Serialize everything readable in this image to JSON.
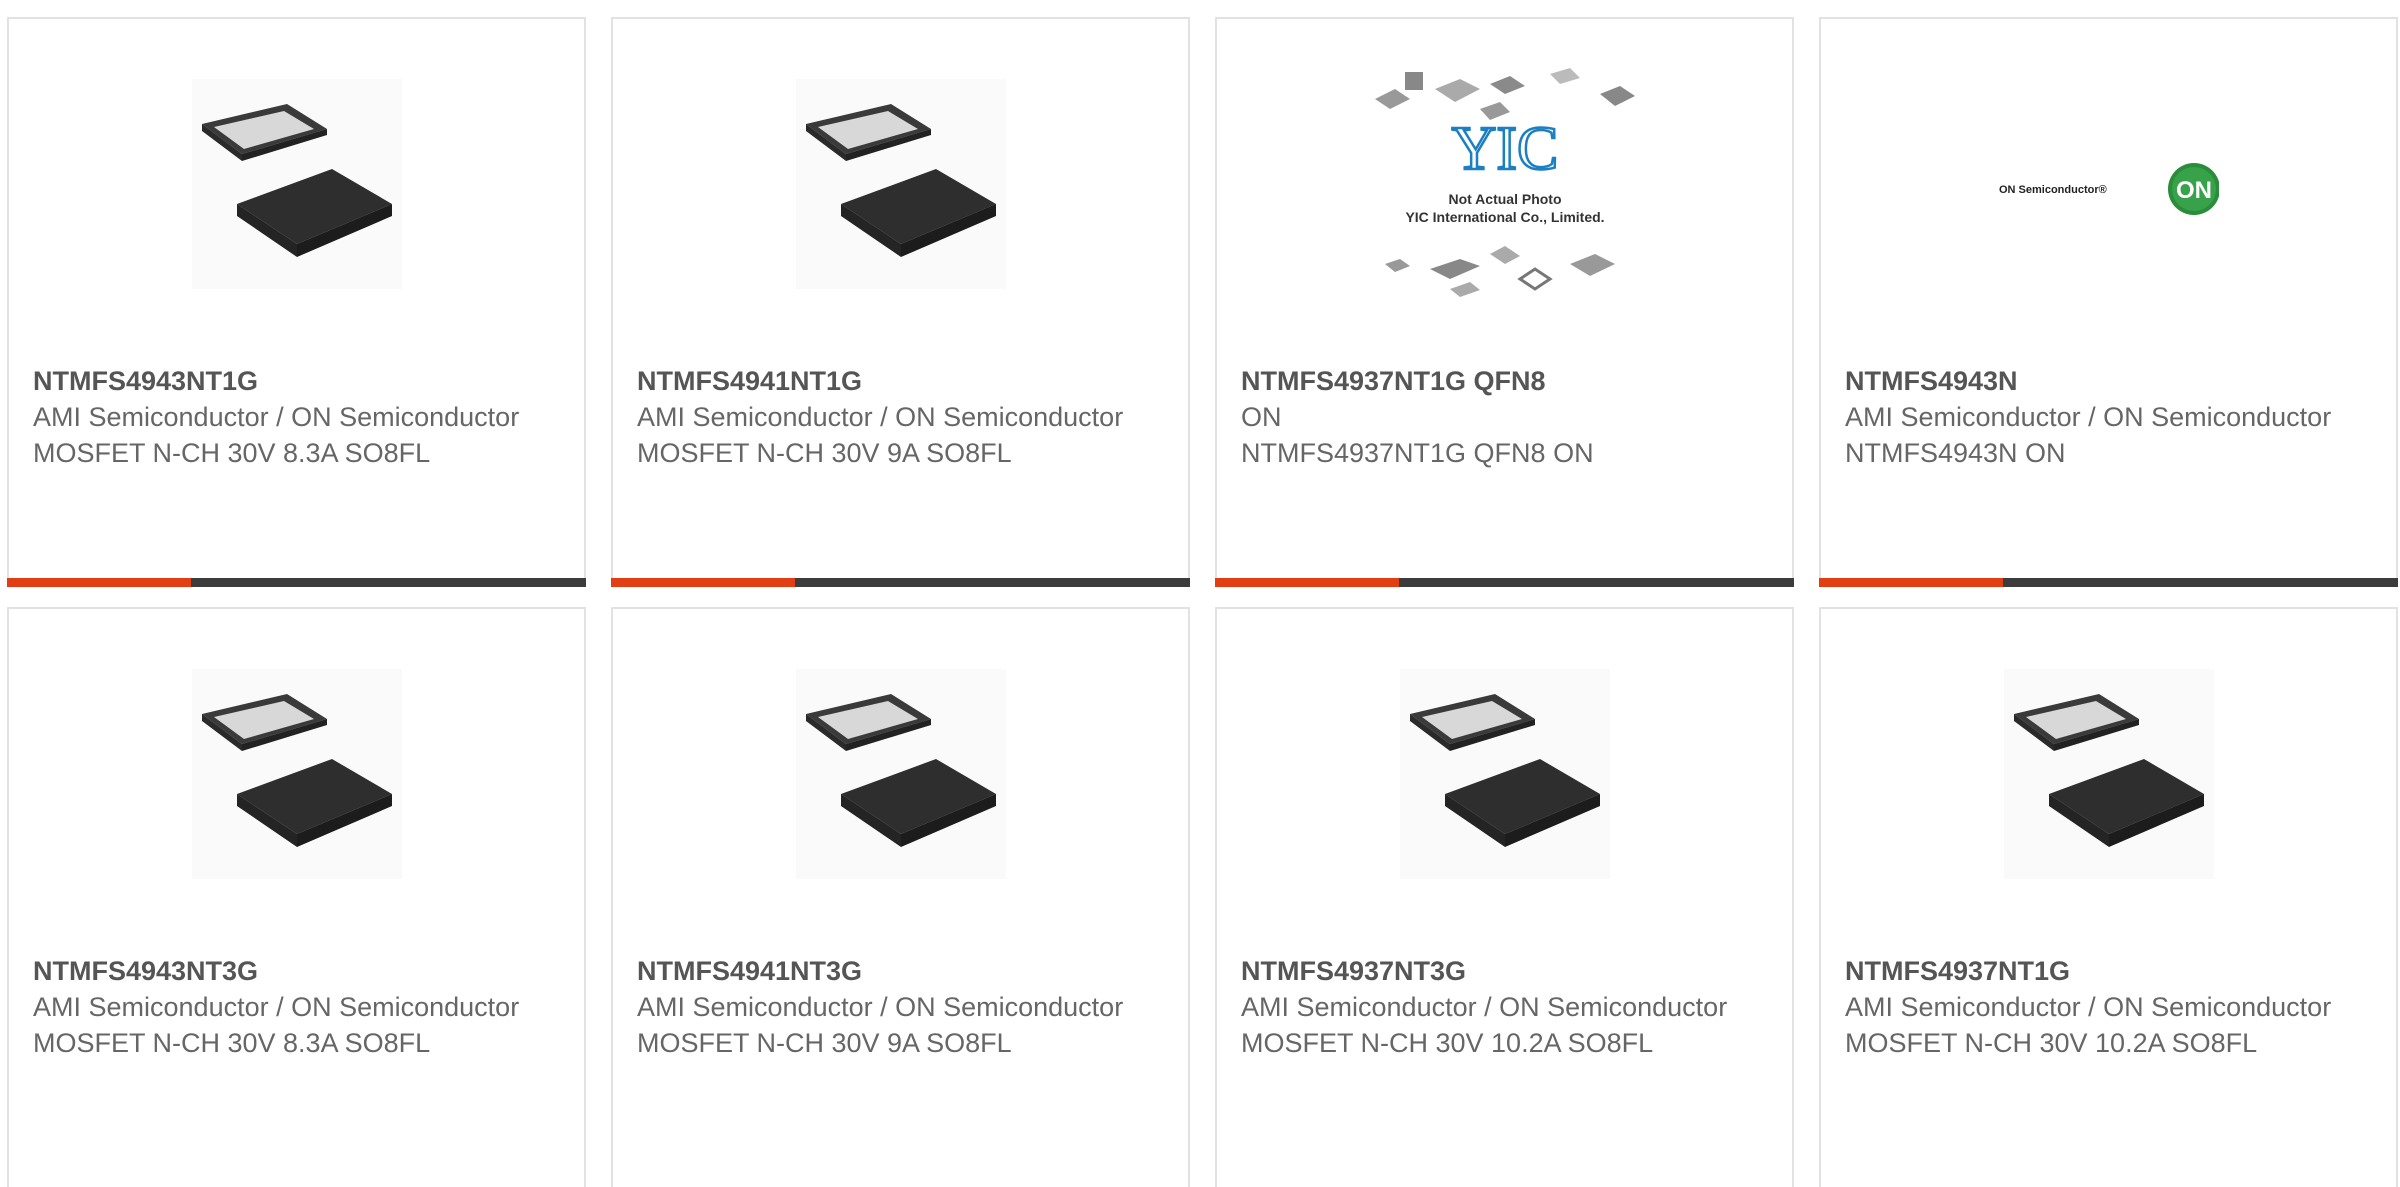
{
  "colors": {
    "accent": "#e23e14",
    "bar_dark": "#3c3c3c",
    "title": "#555555",
    "text": "#666666"
  },
  "products": [
    {
      "name": "NTMFS4943NT1G",
      "manufacturer": "AMI Semiconductor / ON Semiconductor",
      "description": "MOSFET N-CH 30V 8.3A SO8FL",
      "image": "mosfet-package-image"
    },
    {
      "name": "NTMFS4941NT1G",
      "manufacturer": "AMI Semiconductor / ON Semiconductor",
      "description": "MOSFET N-CH 30V 9A SO8FL",
      "image": "mosfet-package-image"
    },
    {
      "name": "NTMFS4937NT1G QFN8",
      "manufacturer": "ON",
      "description": "NTMFS4937NT1G QFN8 ON",
      "image": "not-actual-photo-image",
      "image_text": {
        "logo": "YIC",
        "line1": "Not Actual Photo",
        "line2": "YIC International Co., Limited."
      }
    },
    {
      "name": "NTMFS4943N",
      "manufacturer": "AMI Semiconductor / ON Semiconductor",
      "description": "NTMFS4943N ON",
      "image": "on-semiconductor-logo",
      "image_text": {
        "brand": "ON Semiconductor®",
        "badge": "ON"
      }
    },
    {
      "name": "NTMFS4943NT3G",
      "manufacturer": "AMI Semiconductor / ON Semiconductor",
      "description": "MOSFET N-CH 30V 8.3A SO8FL",
      "image": "mosfet-package-image"
    },
    {
      "name": "NTMFS4941NT3G",
      "manufacturer": "AMI Semiconductor / ON Semiconductor",
      "description": "MOSFET N-CH 30V 9A SO8FL",
      "image": "mosfet-package-image"
    },
    {
      "name": "NTMFS4937NT3G",
      "manufacturer": "AMI Semiconductor / ON Semiconductor",
      "description": "MOSFET N-CH 30V 10.2A SO8FL",
      "image": "mosfet-package-image"
    },
    {
      "name": "NTMFS4937NT1G",
      "manufacturer": "AMI Semiconductor / ON Semiconductor",
      "description": "MOSFET N-CH 30V 10.2A SO8FL",
      "image": "mosfet-package-image"
    }
  ]
}
